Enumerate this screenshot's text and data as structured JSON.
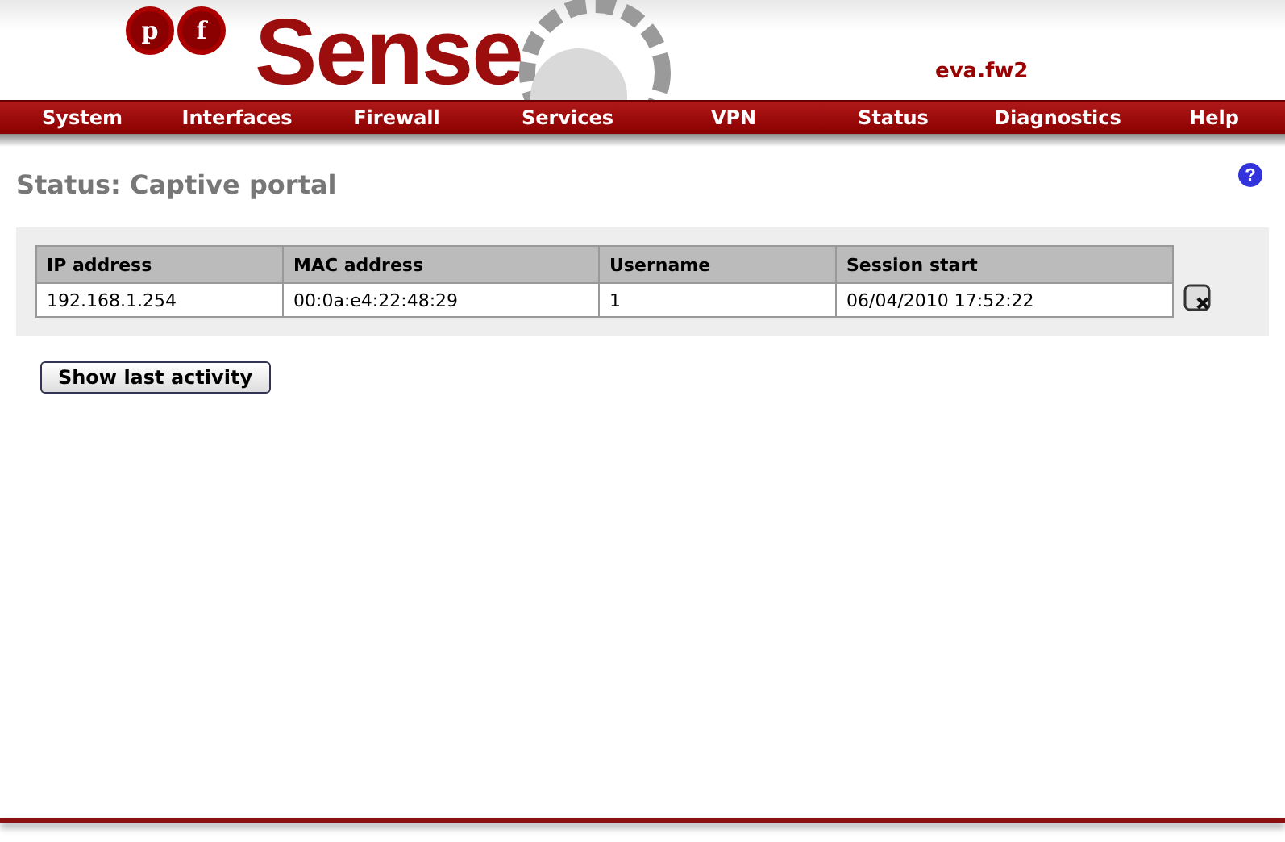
{
  "logo": {
    "letters": [
      "p",
      "f"
    ],
    "wordmark": "Sense"
  },
  "hostname": "eva.fw2",
  "menu": [
    {
      "label": "System"
    },
    {
      "label": "Interfaces"
    },
    {
      "label": "Firewall"
    },
    {
      "label": "Services"
    },
    {
      "label": "VPN"
    },
    {
      "label": "Status"
    },
    {
      "label": "Diagnostics"
    },
    {
      "label": "Help"
    }
  ],
  "page_title": "Status: Captive portal",
  "help": "?",
  "table": {
    "columns": [
      "IP address",
      "MAC address",
      "Username",
      "Session start"
    ],
    "rows": [
      {
        "cells": [
          "192.168.1.254",
          "00:0a:e4:22:48:29",
          "1",
          "06/04/2010 17:52:22"
        ]
      }
    ]
  },
  "button": "Show last activity"
}
